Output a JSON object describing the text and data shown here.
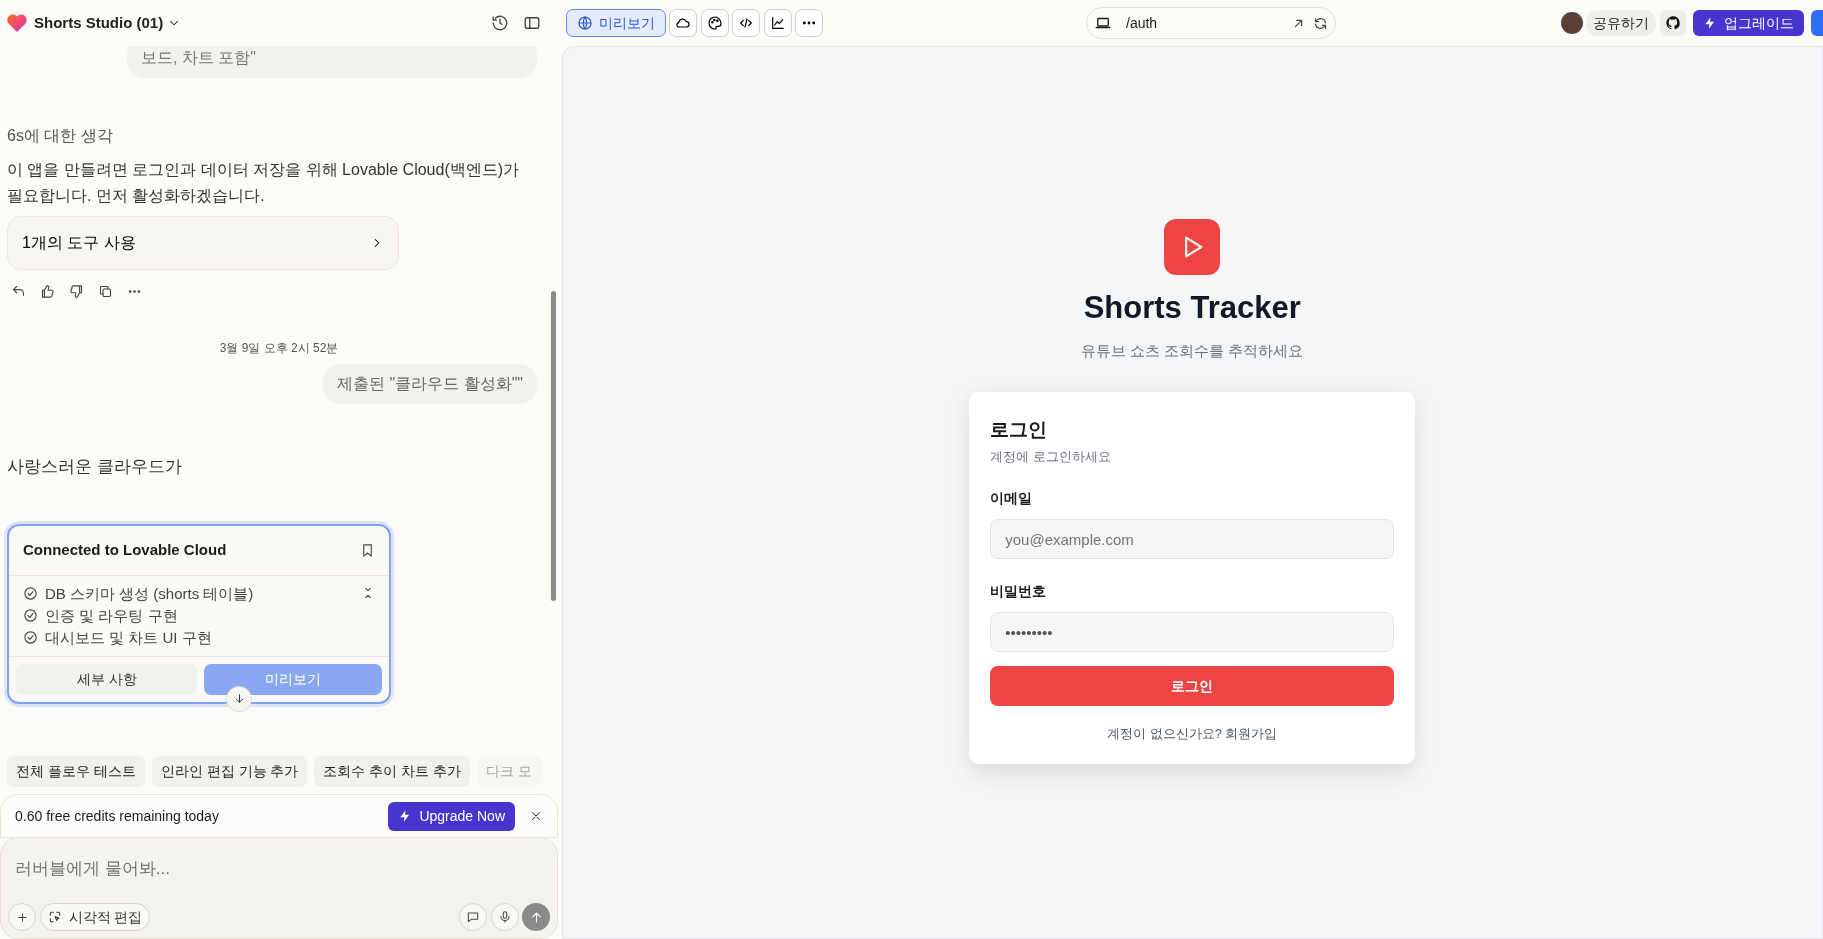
{
  "project": {
    "title": "Shorts Studio (01)"
  },
  "view_tabs": [
    {
      "kind": "globe",
      "label": "미리보기",
      "selected": true
    },
    {
      "kind": "cloud",
      "selected": false
    },
    {
      "kind": "palette",
      "selected": false
    },
    {
      "kind": "code",
      "selected": false
    },
    {
      "kind": "chart",
      "selected": false
    },
    {
      "kind": "more",
      "selected": false
    }
  ],
  "address": {
    "path": "/auth"
  },
  "header_actions": {
    "share": "공유하기",
    "upgrade": "업그레이드"
  },
  "chat": {
    "prev_bubble": "보드, 차트 포함\"",
    "thinking": "6s에 대한 생각",
    "reply": "이 앱을 만들려면 로그인과 데이터 저장을 위해 Lovable Cloud(백엔드)가 필요합니다. 먼저 활성화하겠습니다.",
    "tool_use": "1개의 도구 사용",
    "timestamp": "3월 9일 오후 2시 52분",
    "user_bubble": "제출된 \"클라우드 활성화\"\"",
    "status_line": "사랑스러운 클라우드가",
    "cloud_card": {
      "title": "Connected to Lovable Cloud",
      "tasks": [
        {
          "text": "DB 스키마 생성 (shorts 테이블)",
          "done": true
        },
        {
          "text": "인증 및 라우팅 구현",
          "done": true
        },
        {
          "text": "대시보드 및 차트 UI 구현",
          "done": true
        }
      ],
      "details_button": "세부 사항",
      "preview_button": "미리보기"
    }
  },
  "suggestions": [
    {
      "label": "전체 플로우 테스트",
      "faded": false
    },
    {
      "label": "인라인 편집 기능 추가",
      "faded": false
    },
    {
      "label": "조회수 추이 차트 추가",
      "faded": false
    },
    {
      "label": "다크 모",
      "faded": true
    }
  ],
  "credits": {
    "text": "0.60 free credits remaining today",
    "button": "Upgrade Now"
  },
  "composer": {
    "placeholder": "러버블에게 물어봐...",
    "visual_edit": "시각적 편집"
  },
  "preview": {
    "app_title": "Shorts Tracker",
    "app_subtitle": "유튜브 쇼츠 조회수를 추적하세요",
    "login_card": {
      "title": "로그인",
      "subtitle": "계정에 로그인하세요",
      "fields": [
        {
          "label": "이메일",
          "placeholder": "you@example.com"
        },
        {
          "label": "비밀번호",
          "value": "•••••••••"
        }
      ],
      "submit": "로그인",
      "signup_prompt": "계정이 없으신가요? 회원가입"
    }
  }
}
